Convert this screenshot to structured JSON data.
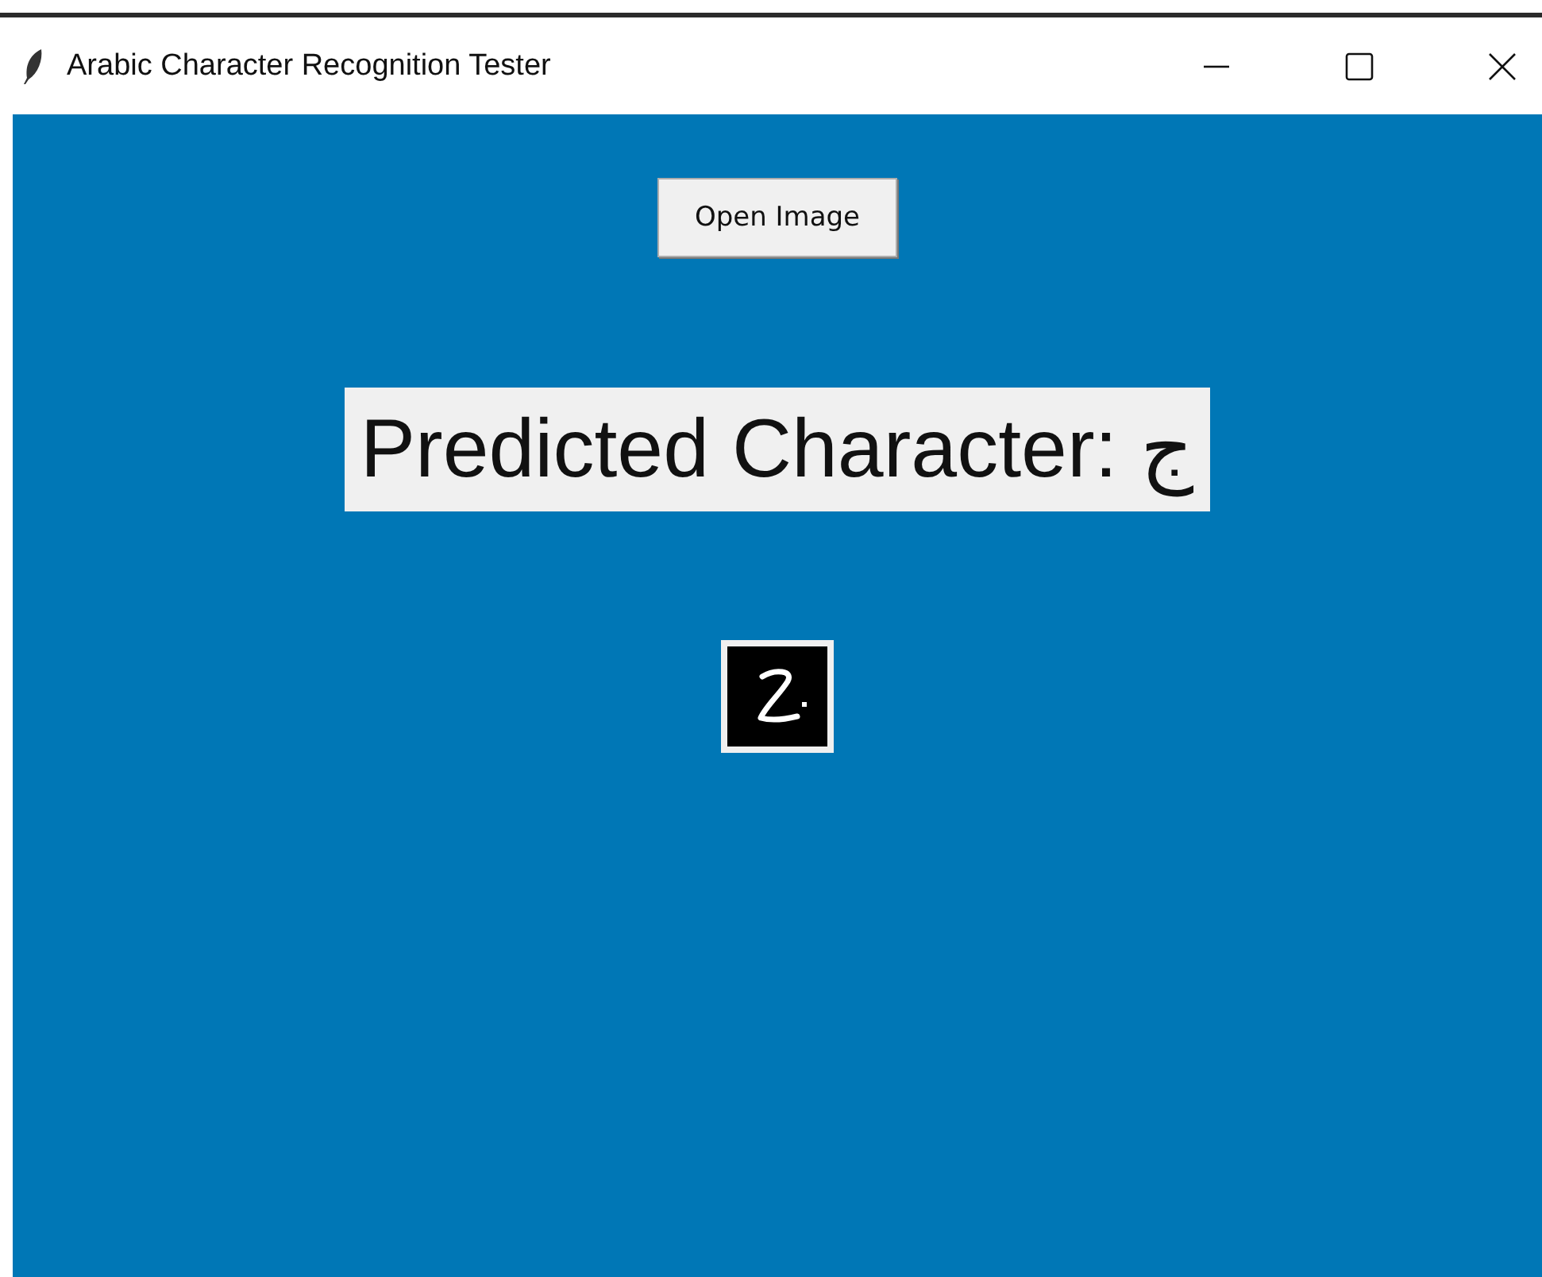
{
  "window": {
    "title": "Arabic Character Recognition Tester"
  },
  "open_button": {
    "label": "Open Image"
  },
  "prediction": {
    "text": "Predicted Character: ج"
  }
}
